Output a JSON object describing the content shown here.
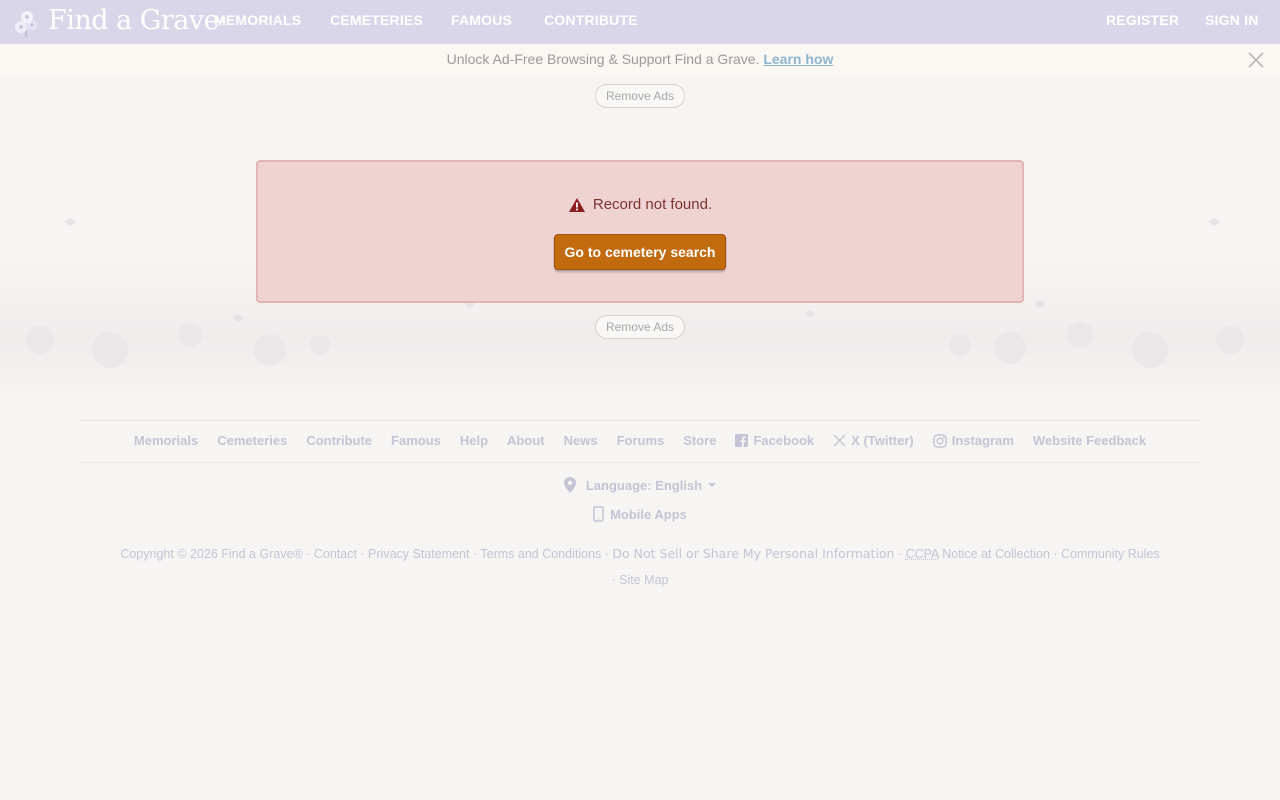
{
  "brand": {
    "name": "Find a Grave",
    "reg": "®"
  },
  "nav": {
    "items": [
      "MEMORIALS",
      "CEMETERIES",
      "FAMOUS",
      "CONTRIBUTE"
    ],
    "register": "REGISTER",
    "sign_in": "SIGN IN"
  },
  "adbar": {
    "text": "Unlock Ad-Free Browsing & Support Find a Grave.",
    "link": "Learn how",
    "remove_ads": "Remove Ads"
  },
  "alert": {
    "message": "Record not found.",
    "button": "Go to cemetery search"
  },
  "footer": {
    "links": [
      "Memorials",
      "Cemeteries",
      "Contribute",
      "Famous",
      "Help",
      "About",
      "News",
      "Forums",
      "Store"
    ],
    "social": [
      "Facebook",
      "X (Twitter)",
      "Instagram"
    ],
    "feedback": "Website Feedback",
    "language": "Language: English",
    "mobile_apps": "Mobile Apps",
    "copyright": "Copyright © 2026 Find a Grave®",
    "contact": "Contact",
    "privacy": "Privacy Statement",
    "terms": "Terms and Conditions",
    "do_not_sell": "Do Not Sell or Share My Personal Information",
    "ccpa": "CCPA",
    "notice": "Notice at Collection",
    "community_rules": "Community Rules",
    "site_map": "Site Map"
  },
  "colors": {
    "nav_bg": "#d8d6e8",
    "alert_bg": "#efd3d3",
    "alert_text": "#7d3431",
    "button_bg": "#c26a0e",
    "link_blue": "#8eb5cf"
  }
}
